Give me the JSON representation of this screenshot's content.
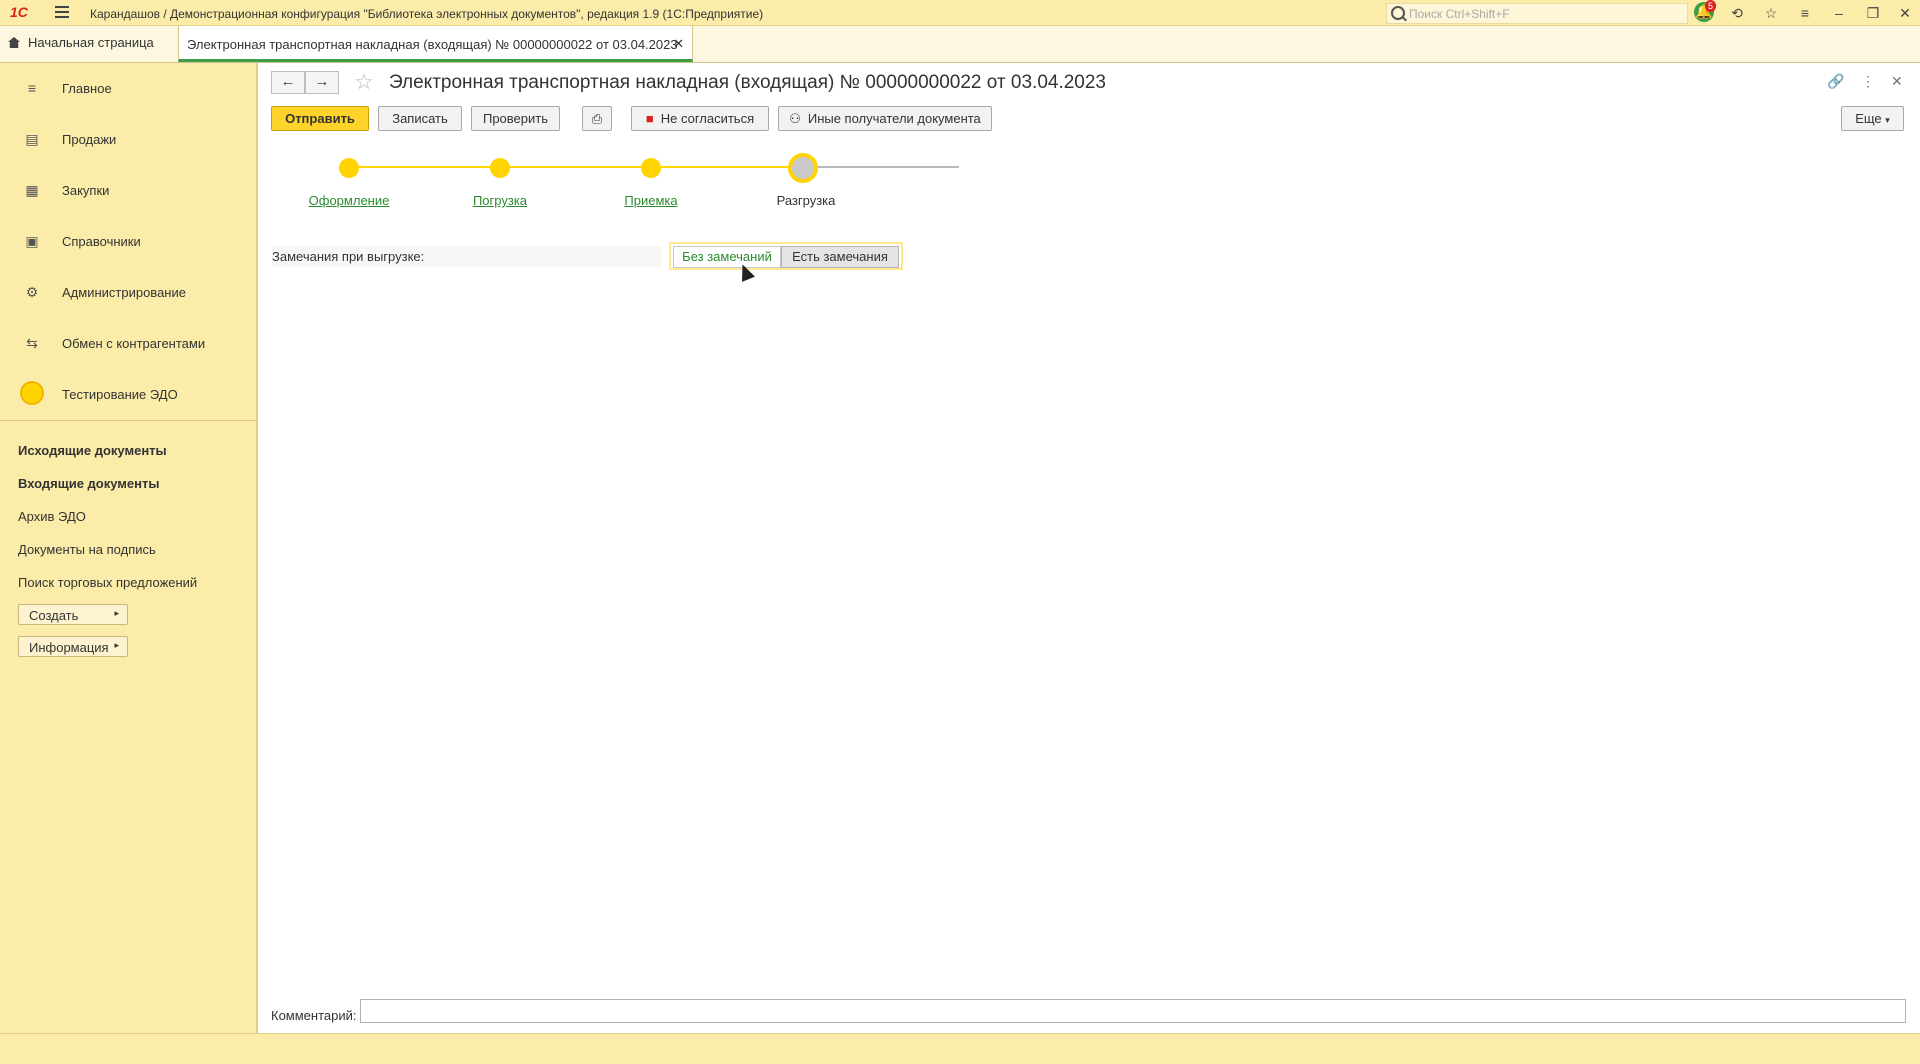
{
  "window": {
    "logo": "1С",
    "title": "Карандашов / Демонстрационная конфигурация \"Библиотека электронных документов\", редакция 1.9  (1С:Предприятие)",
    "search_placeholder": "Поиск Ctrl+Shift+F",
    "notifications_count": "5"
  },
  "tabs": {
    "home_label": "Начальная страница",
    "doc_label": "Электронная транспортная накладная (входящая) № 00000000022 от 03.04.2023"
  },
  "sidebar": {
    "sections": [
      {
        "label": "Главное",
        "icon": "menu-icon"
      },
      {
        "label": "Продажи",
        "icon": "shop-icon"
      },
      {
        "label": "Закупки",
        "icon": "cart-icon"
      },
      {
        "label": "Справочники",
        "icon": "directory-icon"
      },
      {
        "label": "Администрирование",
        "icon": "gear-icon"
      },
      {
        "label": "Обмен с контрагентами",
        "icon": "exchange-icon"
      },
      {
        "label": "Тестирование ЭДО",
        "icon": "circle-icon"
      }
    ],
    "links": [
      {
        "label": "Исходящие документы",
        "bold": true
      },
      {
        "label": "Входящие документы",
        "bold": true
      },
      {
        "label": "Архив ЭДО",
        "bold": false
      },
      {
        "label": "Документы на подпись",
        "bold": false
      },
      {
        "label": "Поиск торговых предложений",
        "bold": false
      }
    ],
    "buttons": {
      "create": "Создать",
      "info": "Информация"
    }
  },
  "document": {
    "title": "Электронная транспортная накладная (входящая) № 00000000022 от 03.04.2023",
    "toolbar": {
      "send": "Отправить",
      "save": "Записать",
      "check": "Проверить",
      "disagree": "Не согласиться",
      "other_recipients": "Иные получатели документа",
      "more": "Еще"
    },
    "steps": [
      {
        "label": "Оформление",
        "done": true
      },
      {
        "label": "Погрузка",
        "done": true
      },
      {
        "label": "Приемка",
        "done": true
      },
      {
        "label": "Разгрузка",
        "done": false
      }
    ],
    "remarks": {
      "label": "Замечания при выгрузке:",
      "option_no": "Без замечаний",
      "option_yes": "Есть замечания"
    },
    "comment": {
      "label": "Комментарий:",
      "value": ""
    }
  },
  "colors": {
    "accent": "#ffd400",
    "link": "#2b8b2e",
    "panel": "#fbeda9"
  }
}
